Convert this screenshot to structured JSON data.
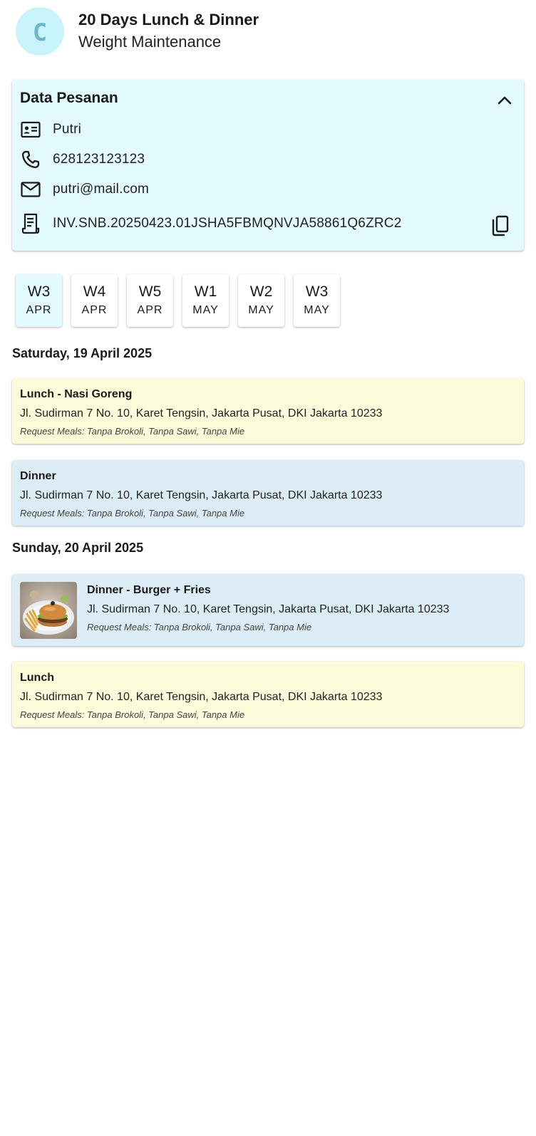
{
  "header": {
    "avatar_letter": "C",
    "title": "20 Days Lunch & Dinner",
    "subtitle": "Weight Maintenance"
  },
  "order": {
    "title": "Data Pesanan",
    "name": "Putri",
    "phone": "628123123123",
    "email": "putri@mail.com",
    "invoice": "INV.SNB.20250423.01JSHA5FBMQNVJA58861Q6ZRC2"
  },
  "weeks": [
    {
      "week": "W3",
      "month": "APR",
      "active": true
    },
    {
      "week": "W4",
      "month": "APR",
      "active": false
    },
    {
      "week": "W5",
      "month": "APR",
      "active": false
    },
    {
      "week": "W1",
      "month": "MAY",
      "active": false
    },
    {
      "week": "W2",
      "month": "MAY",
      "active": false
    },
    {
      "week": "W3",
      "month": "MAY",
      "active": false
    }
  ],
  "days": [
    {
      "date": "Saturday, 19 April 2025",
      "meals": [
        {
          "title": "Lunch - Nasi Goreng",
          "address": "Jl. Sudirman 7 No. 10, Karet Tengsin, Jakarta Pusat, DKI Jakarta 10233",
          "request": "Request Meals: Tanpa Brokoli, Tanpa Sawi, Tanpa Mie"
        },
        {
          "title": "Dinner",
          "address": "Jl. Sudirman 7 No. 10, Karet Tengsin, Jakarta Pusat, DKI Jakarta 10233",
          "request": "Request Meals: Tanpa Brokoli, Tanpa Sawi, Tanpa Mie"
        }
      ]
    },
    {
      "date": "Sunday, 20 April 2025",
      "meals": [
        {
          "title": "Dinner - Burger + Fries",
          "address": "Jl. Sudirman 7 No. 10, Karet Tengsin, Jakarta Pusat, DKI Jakarta 10233",
          "request": "Request Meals: Tanpa Brokoli, Tanpa Sawi, Tanpa Mie"
        },
        {
          "title": "Lunch",
          "address": "Jl. Sudirman 7 No. 10, Karet Tengsin, Jakarta Pusat, DKI Jakarta 10233",
          "request": "Request Meals: Tanpa Brokoli, Tanpa Sawi, Tanpa Mie"
        }
      ]
    }
  ],
  "colors": {
    "avatar_bg": "#c8f3fb",
    "order_card_bg": "#e3fbfe",
    "lunch_bg": "#fcfcdb",
    "dinner_bg": "#ddedf7"
  },
  "icons": [
    "contact-card-icon",
    "phone-icon",
    "mail-icon",
    "receipt-icon",
    "copy-icon",
    "chevron-up-icon"
  ]
}
